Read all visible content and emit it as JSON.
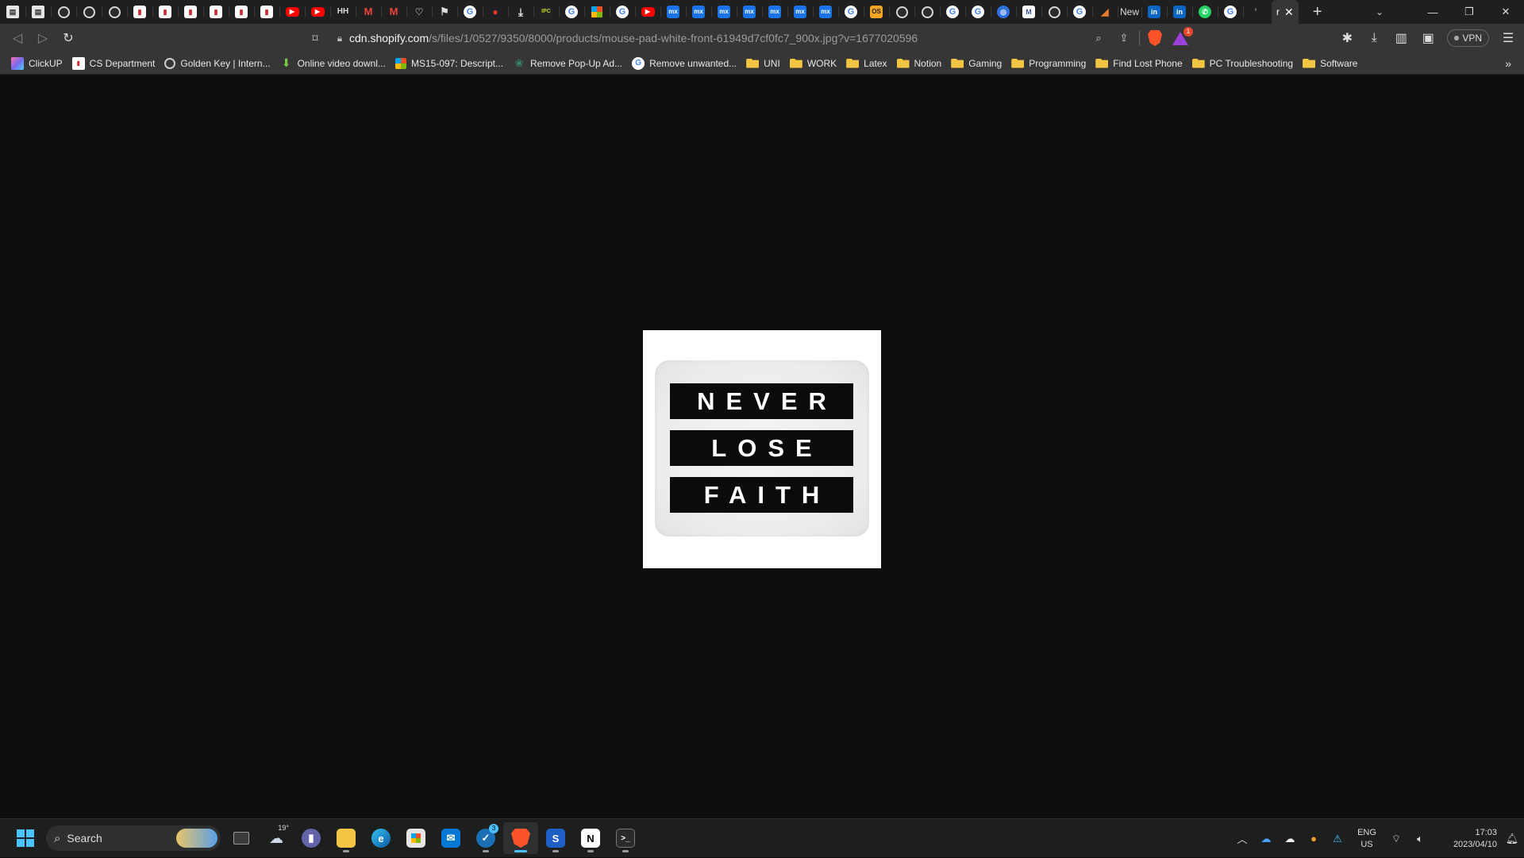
{
  "tabs": {
    "favicons": [
      {
        "icon": "document-icon",
        "kind": "doc",
        "glyph": "▤"
      },
      {
        "icon": "document-icon",
        "kind": "doc",
        "glyph": "▤"
      },
      {
        "icon": "globe-icon",
        "kind": "circle",
        "glyph": ""
      },
      {
        "icon": "globe-icon",
        "kind": "circle",
        "glyph": ""
      },
      {
        "icon": "globe-icon",
        "kind": "circle",
        "glyph": ""
      },
      {
        "icon": "pdf-icon",
        "kind": "pdf",
        "glyph": "▮"
      },
      {
        "icon": "pdf-icon",
        "kind": "pdf",
        "glyph": "▮"
      },
      {
        "icon": "pdf-icon",
        "kind": "pdf",
        "glyph": "▮"
      },
      {
        "icon": "pdf-icon",
        "kind": "pdf",
        "glyph": "▮"
      },
      {
        "icon": "pdf-icon",
        "kind": "pdf",
        "glyph": "▮"
      },
      {
        "icon": "pdf-icon",
        "kind": "pdf",
        "glyph": "▮"
      },
      {
        "icon": "youtube-icon",
        "kind": "yt",
        "glyph": "▶"
      },
      {
        "icon": "youtube-icon",
        "kind": "yt",
        "glyph": "▶"
      },
      {
        "icon": "keyboard-icon",
        "kind": "kbd",
        "glyph": "HH"
      },
      {
        "icon": "gmail-icon",
        "kind": "gm",
        "glyph": "M"
      },
      {
        "icon": "gmail-icon",
        "kind": "gm",
        "glyph": "M"
      },
      {
        "icon": "heart-icon",
        "kind": "heart",
        "glyph": "♡"
      },
      {
        "icon": "flag-icon",
        "kind": "flag",
        "glyph": "⚑"
      },
      {
        "icon": "google-icon",
        "kind": "g",
        "glyph": "G"
      },
      {
        "icon": "red-app-icon",
        "kind": "red",
        "glyph": "●"
      },
      {
        "icon": "download-icon",
        "kind": "dl",
        "glyph": "⤓"
      },
      {
        "icon": "ipc-icon",
        "kind": "ipc",
        "glyph": "IPC"
      },
      {
        "icon": "google-icon",
        "kind": "g",
        "glyph": "G"
      },
      {
        "icon": "microsoft-icon",
        "kind": "ms",
        "glyph": ""
      },
      {
        "icon": "google-icon",
        "kind": "g",
        "glyph": "G"
      },
      {
        "icon": "youtube-icon",
        "kind": "yt",
        "glyph": "▶"
      },
      {
        "icon": "mx-icon",
        "kind": "mx",
        "glyph": "mx"
      },
      {
        "icon": "mx-icon",
        "kind": "mx",
        "glyph": "mx"
      },
      {
        "icon": "mx-icon",
        "kind": "mx",
        "glyph": "mx"
      },
      {
        "icon": "mx-icon",
        "kind": "mx",
        "glyph": "mx"
      },
      {
        "icon": "mx-icon",
        "kind": "mx",
        "glyph": "mx"
      },
      {
        "icon": "mx-icon",
        "kind": "mx",
        "glyph": "mx"
      },
      {
        "icon": "mx-icon",
        "kind": "mx",
        "glyph": "mx"
      },
      {
        "icon": "google-icon",
        "kind": "g",
        "glyph": "G"
      },
      {
        "icon": "os-icon",
        "kind": "os",
        "glyph": "OS"
      },
      {
        "icon": "globe-icon",
        "kind": "circle",
        "glyph": ""
      },
      {
        "icon": "globe-icon",
        "kind": "circle",
        "glyph": ""
      },
      {
        "icon": "google-icon",
        "kind": "g",
        "glyph": "G"
      },
      {
        "icon": "google-icon",
        "kind": "g",
        "glyph": "G"
      },
      {
        "icon": "blue-app-icon",
        "kind": "blue",
        "glyph": "◎"
      },
      {
        "icon": "mw-icon",
        "kind": "mw",
        "glyph": "M"
      },
      {
        "icon": "globe-icon",
        "kind": "circle",
        "glyph": ""
      },
      {
        "icon": "google-icon",
        "kind": "g",
        "glyph": "G"
      },
      {
        "icon": "chart-app-icon",
        "kind": "orange",
        "glyph": "◢"
      }
    ],
    "text_tab": "New",
    "favicons_after": [
      {
        "icon": "linkedin-icon",
        "kind": "li",
        "glyph": "in"
      },
      {
        "icon": "linkedin-icon",
        "kind": "li",
        "glyph": "in"
      },
      {
        "icon": "whatsapp-icon",
        "kind": "wa",
        "glyph": "✆"
      },
      {
        "icon": "google-icon",
        "kind": "g",
        "glyph": "G"
      },
      {
        "icon": "blank-tab-icon",
        "kind": "heart",
        "glyph": "'"
      }
    ],
    "active_tab_text": "r",
    "new_tab_label": "+"
  },
  "url": {
    "host": "cdn.shopify.com",
    "path": "/s/files/1/0527/9350/8000/products/mouse-pad-white-front-61949d7cf0fc7_900x.jpg?v=1677020596"
  },
  "toolbar": {
    "vpn_label": "VPN",
    "rewards_badge": "1"
  },
  "bookmarks": [
    {
      "label": "ClickUP",
      "icon": "clickup-icon",
      "kind": "clickup"
    },
    {
      "label": "CS Department",
      "icon": "pdf-icon",
      "kind": "pdf"
    },
    {
      "label": "Golden Key | Intern...",
      "icon": "globe-icon",
      "kind": "gk"
    },
    {
      "label": "Online video downl...",
      "icon": "download-icon",
      "kind": "dl"
    },
    {
      "label": "MS15-097: Descript...",
      "icon": "microsoft-icon",
      "kind": "ms"
    },
    {
      "label": "Remove Pop-Up Ad...",
      "icon": "leaf-icon",
      "kind": "leaf"
    },
    {
      "label": "Remove unwanted...",
      "icon": "google-icon",
      "kind": "g"
    },
    {
      "label": "UNI",
      "icon": "folder-icon",
      "kind": "folder"
    },
    {
      "label": "WORK",
      "icon": "folder-icon",
      "kind": "folder"
    },
    {
      "label": "Latex",
      "icon": "folder-icon",
      "kind": "folder"
    },
    {
      "label": "Notion",
      "icon": "folder-icon",
      "kind": "folder"
    },
    {
      "label": "Gaming",
      "icon": "folder-icon",
      "kind": "folder"
    },
    {
      "label": "Programming",
      "icon": "folder-icon",
      "kind": "folder"
    },
    {
      "label": "Find Lost Phone",
      "icon": "folder-icon",
      "kind": "folder"
    },
    {
      "label": "PC Troubleshooting",
      "icon": "folder-icon",
      "kind": "folder"
    },
    {
      "label": "Software",
      "icon": "folder-icon",
      "kind": "folder"
    }
  ],
  "image": {
    "lines": [
      "NEVER",
      "LOSE",
      "FAITH"
    ]
  },
  "taskbar": {
    "search_label": "Search",
    "weather_temp": "19°",
    "steam_badge": "3",
    "lang_line1": "ENG",
    "lang_line2": "US",
    "time": "17:03",
    "date": "2023/04/10"
  },
  "colors": {
    "background": "#0e0e0e",
    "chrome_dark": "#1f1f1f",
    "chrome": "#363636",
    "accent": "#4cc2ff",
    "brave": "#fb542b"
  }
}
